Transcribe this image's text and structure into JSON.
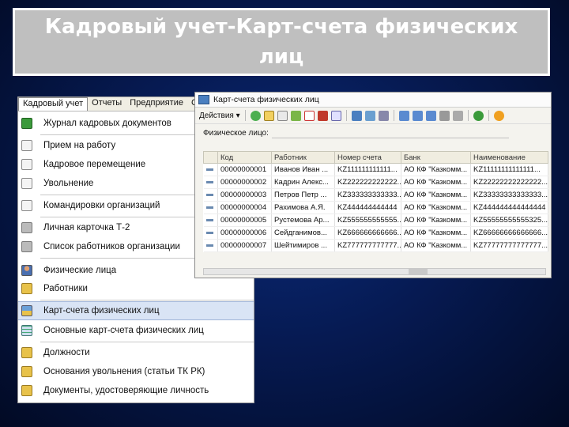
{
  "slide": {
    "title": "Кадровый учет-Карт-счета физических лиц"
  },
  "menu": {
    "bar": [
      "Кадровый учет",
      "Отчеты",
      "Предприятие",
      "С"
    ],
    "items": [
      {
        "label": "Журнал кадровых документов",
        "icon": "journal-icon"
      },
      {
        "label": "Прием на работу",
        "icon": "document-icon"
      },
      {
        "label": "Кадровое перемещение",
        "icon": "document-icon"
      },
      {
        "label": "Увольнение",
        "icon": "document-icon"
      },
      {
        "label": "Командировки организаций",
        "icon": "document-icon"
      },
      {
        "label": "Личная карточка Т-2",
        "icon": "report-icon"
      },
      {
        "label": "Список работников организации",
        "icon": "report-icon"
      },
      {
        "label": "Физические лица",
        "icon": "person-icon"
      },
      {
        "label": "Работники",
        "icon": "book-icon"
      },
      {
        "label": "Карт-счета физических лиц",
        "icon": "card-icon"
      },
      {
        "label": "Основные карт-счета физических лиц",
        "icon": "grid-icon"
      },
      {
        "label": "Должности",
        "icon": "book-icon"
      },
      {
        "label": "Основания увольнения (статьи ТК РК)",
        "icon": "book-icon"
      },
      {
        "label": "Документы, удостоверяющие личность",
        "icon": "book-icon"
      }
    ]
  },
  "window": {
    "title": "Карт-счета физических лиц",
    "actions_label": "Действия ▾",
    "filter_label": "Физическое лицо:",
    "columns": [
      "Код",
      "Работник",
      "Номер счета",
      "Банк",
      "Наименование"
    ],
    "rows": [
      [
        "00000000001",
        "Иванов Иван ...",
        "KZ111111111111...",
        "АО КФ \"Казкомм...",
        "KZ11111111111111..."
      ],
      [
        "00000000002",
        "Кадрин Алекс...",
        "KZ222222222222...",
        "АО КФ \"Казкомм...",
        "KZ22222222222222..."
      ],
      [
        "00000000003",
        "Петров Петр ...",
        "KZ333333333333...",
        "АО КФ \"Казкомм...",
        "KZ33333333333333..."
      ],
      [
        "00000000004",
        "Рахимова А.Я.",
        "KZ444444444444",
        "АО КФ \"Казкомм...",
        "KZ444444444444444"
      ],
      [
        "00000000005",
        "Рустемова Ар...",
        "KZ555555555555...",
        "АО КФ \"Казкомм...",
        "KZ55555555555325..."
      ],
      [
        "00000000006",
        "Сейдганимов...",
        "KZ666666666666...",
        "АО КФ \"Казкомм...",
        "KZ66666666666666..."
      ],
      [
        "00000000007",
        "Шейтимиров ...",
        "KZ777777777777...",
        "АО КФ \"Казкомм...",
        "KZ77777777777777..."
      ]
    ]
  },
  "colors": {
    "background": "#061a52",
    "title_box": "#bfbfbf",
    "selection": "#d9e4f5"
  }
}
